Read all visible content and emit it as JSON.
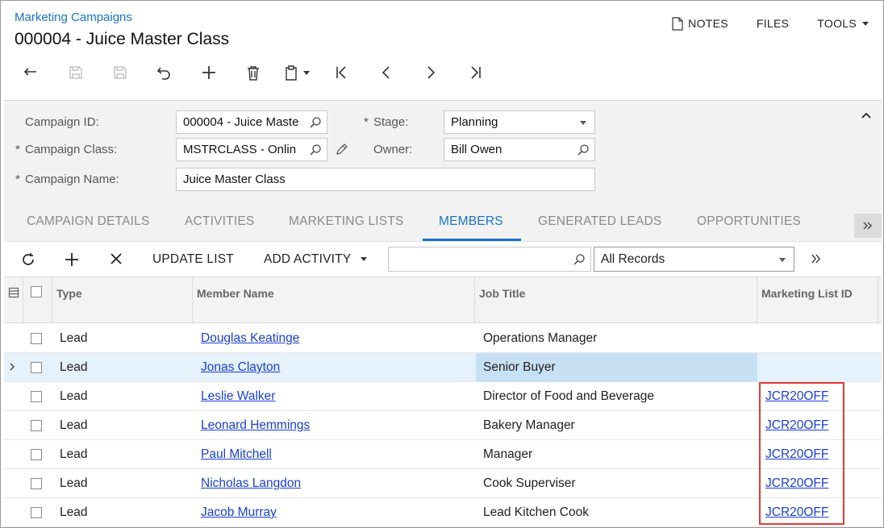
{
  "header": {
    "breadcrumb": "Marketing Campaigns",
    "title": "000004 - Juice Master Class",
    "actions": [
      {
        "label": "NOTES",
        "icon": "document-icon"
      },
      {
        "label": "FILES"
      },
      {
        "label": "TOOLS",
        "icon": "caret-down-icon"
      }
    ]
  },
  "toolbar": {
    "buttons": [
      "back-icon",
      "save-and-close-icon",
      "save-icon",
      "undo-icon",
      "add-icon",
      "delete-icon",
      "clipboard-icon",
      "first-record-icon",
      "previous-record-icon",
      "next-record-icon",
      "last-record-icon"
    ]
  },
  "form": {
    "campaign_id": {
      "label": "Campaign ID:",
      "value": "000004 - Juice Maste"
    },
    "campaign_class": {
      "label": "Campaign Class:",
      "value": "MSTRCLASS - Onlin"
    },
    "campaign_name": {
      "label": "Campaign Name:",
      "value": "Juice Master Class"
    },
    "stage": {
      "label": "Stage:",
      "value": "Planning"
    },
    "owner": {
      "label": "Owner:",
      "value": "Bill Owen"
    },
    "required_marker": "*"
  },
  "tabs": [
    {
      "label": "CAMPAIGN DETAILS",
      "active": false
    },
    {
      "label": "ACTIVITIES",
      "active": false
    },
    {
      "label": "MARKETING LISTS",
      "active": false
    },
    {
      "label": "MEMBERS",
      "active": true
    },
    {
      "label": "GENERATED LEADS",
      "active": false
    },
    {
      "label": "OPPORTUNITIES",
      "active": false
    }
  ],
  "grid_toolbar": {
    "update_list": "UPDATE LIST",
    "add_activity": "ADD ACTIVITY",
    "search_value": "",
    "filter_value": "All Records"
  },
  "table": {
    "columns": [
      "Type",
      "Member Name",
      "Job Title",
      "Marketing List ID"
    ],
    "rows": [
      {
        "type": "Lead",
        "member_name": "Douglas Keatinge",
        "job_title": "Operations Manager",
        "marketing_list_id": ""
      },
      {
        "type": "Lead",
        "member_name": "Jonas Clayton",
        "job_title": "Senior Buyer",
        "marketing_list_id": "",
        "selected": true
      },
      {
        "type": "Lead",
        "member_name": "Leslie Walker",
        "job_title": "Director of Food and Beverage",
        "marketing_list_id": "JCR20OFF"
      },
      {
        "type": "Lead",
        "member_name": "Leonard Hemmings",
        "job_title": "Bakery Manager",
        "marketing_list_id": "JCR20OFF"
      },
      {
        "type": "Lead",
        "member_name": "Paul Mitchell",
        "job_title": "Manager",
        "marketing_list_id": "JCR20OFF"
      },
      {
        "type": "Lead",
        "member_name": "Nicholas Langdon",
        "job_title": "Cook Superviser",
        "marketing_list_id": "JCR20OFF"
      },
      {
        "type": "Lead",
        "member_name": "Jacob Murray",
        "job_title": "Lead Kitchen Cook",
        "marketing_list_id": "JCR20OFF"
      }
    ]
  },
  "colors": {
    "accent": "#1a73c8",
    "link": "#1a3fd4",
    "highlight_box": "#e03a3a",
    "selected_row": "#e5f1fb"
  }
}
